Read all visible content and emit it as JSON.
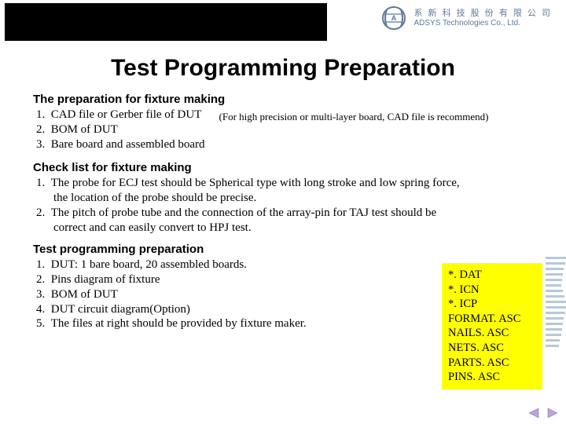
{
  "header": {
    "company_cn": "系 新 科 技 股 份 有 限 公 司",
    "company_en": "ADSYS Technologies Co., Ltd."
  },
  "title": "Test Programming Preparation",
  "prep_fixture": {
    "label": "The preparation for fixture making",
    "items": [
      "CAD file or Gerber file of DUT",
      "BOM of DUT",
      "Bare board and assembled board"
    ],
    "note": "(For high precision or multi-layer board, CAD file is recommend)"
  },
  "checklist": {
    "label": "Check list for fixture making",
    "items": [
      "The probe for ECJ test should be Spherical type with long stroke and low spring force, the location of the probe should be precise.",
      "The pitch of probe tube and the connection of the array-pin for TAJ test should be correct and can easily convert to HPJ test."
    ]
  },
  "tpp": {
    "label": "Test programming preparation",
    "items": [
      "DUT: 1 bare board, 20 assembled boards.",
      "Pins diagram of fixture",
      "BOM of DUT",
      "DUT circuit diagram(Option)",
      "The files at right should be provided by fixture maker."
    ]
  },
  "files": [
    "*. DAT",
    "*. ICN",
    "*. ICP",
    "FORMAT. ASC",
    "NAILS. ASC",
    "NETS. ASC",
    "PARTS. ASC",
    "PINS. ASC"
  ]
}
